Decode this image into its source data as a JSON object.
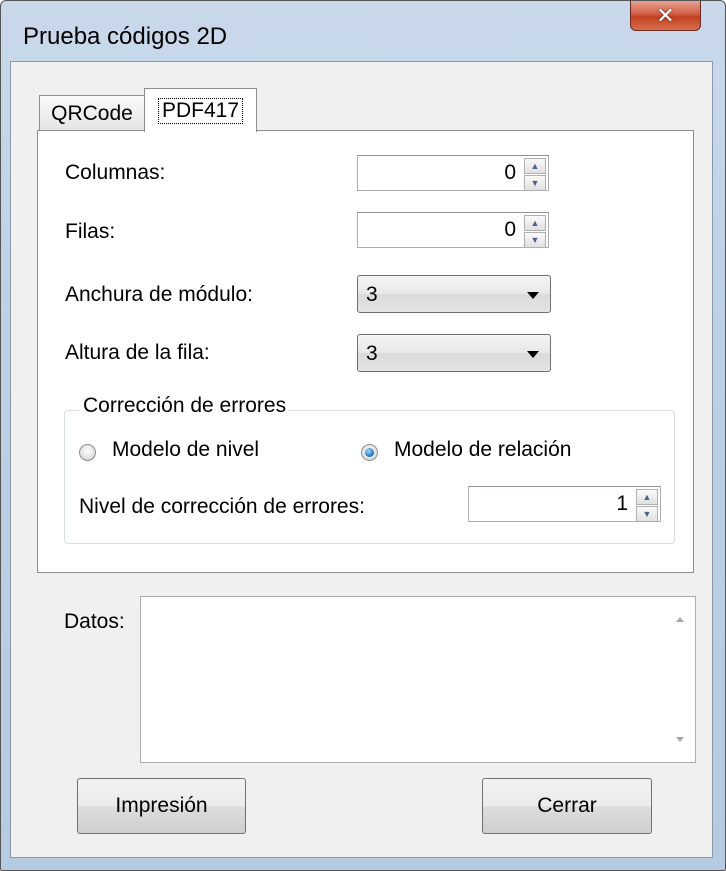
{
  "window": {
    "title": "Prueba códigos 2D",
    "close_glyph": "✕"
  },
  "tabs": [
    {
      "label": "QRCode",
      "active": false
    },
    {
      "label": "PDF417",
      "active": true
    }
  ],
  "pdf417": {
    "columnas_label": "Columnas:",
    "columnas_value": "0",
    "filas_label": "Filas:",
    "filas_value": "0",
    "anchura_label": "Anchura de módulo:",
    "anchura_value": "3",
    "altura_label": "Altura de la fila:",
    "altura_value": "3",
    "correccion": {
      "legend": "Corrección de errores",
      "radio_nivel_label": "Modelo de nivel",
      "radio_nivel_checked": false,
      "radio_relacion_label": "Modelo de relación",
      "radio_relacion_checked": true,
      "nivel_label": "Nivel de corrección de errores:",
      "nivel_value": "1"
    }
  },
  "datos": {
    "label": "Datos:",
    "value": ""
  },
  "buttons": {
    "print_label": "Impresión",
    "close_label": "Cerrar"
  },
  "icons": {
    "spin_up": "▲",
    "spin_down": "▼"
  }
}
